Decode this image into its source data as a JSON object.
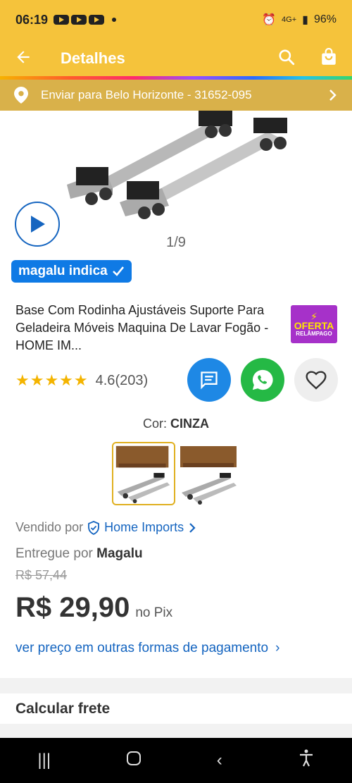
{
  "status": {
    "time": "06:19",
    "battery": "96%",
    "network": "4G+"
  },
  "header": {
    "title": "Detalhes",
    "back_icon": "arrow-left-icon",
    "search_icon": "search-icon",
    "bag_icon": "bag-icon"
  },
  "address": {
    "text": "Enviar para Belo Horizonte - 31652-095"
  },
  "gallery": {
    "pager": "1/9"
  },
  "badge": {
    "label": "magalu indica"
  },
  "product": {
    "title": "Base Com Rodinha Ajustáveis Suporte Para Geladeira Móveis Maquina De Lavar Fogão - HOME IM...",
    "oferta_line1": "OFERTA",
    "oferta_line2": "RELÂMPAGO",
    "stars": "★★★★★",
    "rating": "4.6",
    "reviews": "(203)"
  },
  "color": {
    "label": "Cor:",
    "value": "CINZA"
  },
  "seller": {
    "label": "Vendido por",
    "name": "Home Imports"
  },
  "delivery": {
    "label": "Entregue por",
    "name": "Magalu"
  },
  "pricing": {
    "old_price": "R$ 57,44",
    "price": "R$ 29,90",
    "method": "no Pix",
    "other_payments": "ver preço em outras formas de pagamento"
  },
  "shipping": {
    "title": "Calcular frete"
  },
  "colors": {
    "brand_yellow": "#f5c33b",
    "accent_blue": "#0f7ae5",
    "whatsapp_green": "#25b945"
  }
}
